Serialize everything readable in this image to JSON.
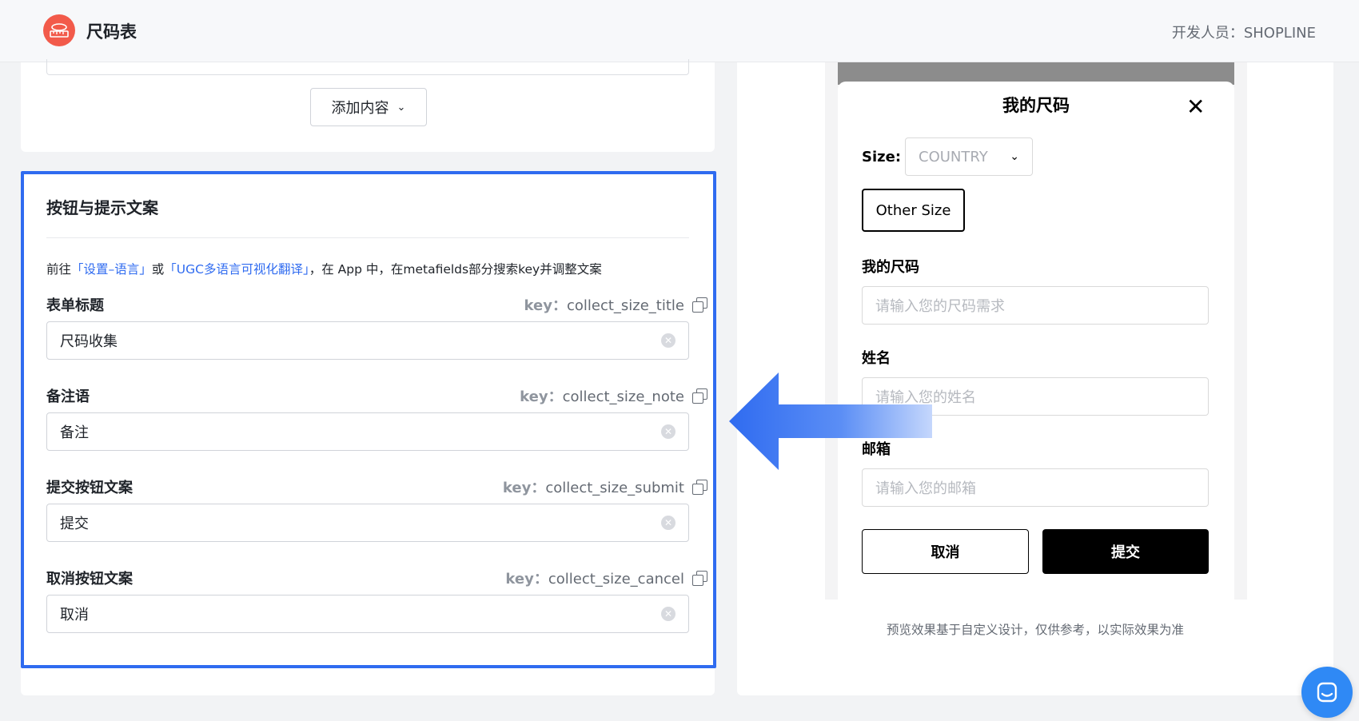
{
  "header": {
    "app_title": "尺码表",
    "developer": "开发人员：SHOPLINE"
  },
  "left": {
    "add_content_label": "添加内容",
    "section_title": "按钮与提示文案",
    "hint": {
      "prefix": "前往",
      "link1": "「设置–语言」",
      "middle": "或",
      "link2": "「UGC多语言可视化翻译」",
      "suffix": "，在 App 中，在metafields部分搜索key并调整文案"
    },
    "key_prefix": "key：",
    "fields": [
      {
        "label": "表单标题",
        "key": "collect_size_title",
        "value": "尺码收集"
      },
      {
        "label": "备注语",
        "key": "collect_size_note",
        "value": "备注"
      },
      {
        "label": "提交按钮文案",
        "key": "collect_size_submit",
        "value": "提交"
      },
      {
        "label": "取消按钮文案",
        "key": "collect_size_cancel",
        "value": "取消"
      }
    ]
  },
  "preview": {
    "modal_title": "我的尺码",
    "size_label": "Size:",
    "size_select_value": "COUNTRY",
    "other_size": "Other Size",
    "my_size_label": "我的尺码",
    "my_size_placeholder": "请输入您的尺码需求",
    "name_label": "姓名",
    "name_placeholder": "请输入您的姓名",
    "email_label": "邮箱",
    "email_placeholder": "请输入您的邮箱",
    "cancel": "取消",
    "submit": "提交",
    "note": "预览效果基于自定义设计，仅供参考，以实际效果为准"
  },
  "colors": {
    "accent": "#2f6bf0",
    "logo": "#f25a4a",
    "chat": "#2f89f5"
  }
}
